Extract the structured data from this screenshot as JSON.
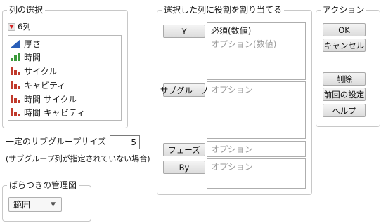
{
  "columns_panel": {
    "title": "列の選択",
    "count": "6列",
    "items": [
      {
        "label": "厚さ",
        "icon": "continuous-icon"
      },
      {
        "label": "時間",
        "icon": "ordinal-icon"
      },
      {
        "label": "サイクル",
        "icon": "nominal-icon"
      },
      {
        "label": "キャビティ",
        "icon": "nominal-icon"
      },
      {
        "label": "時間 サイクル",
        "icon": "nominal-icon"
      },
      {
        "label": "時間 キャビティ",
        "icon": "nominal-icon"
      }
    ]
  },
  "subgroup_size": {
    "label": "一定のサブグループサイズ",
    "value": "5",
    "note": "(サブグループ列が指定されていない場合)"
  },
  "chart_type": {
    "title": "ばらつきの管理図",
    "selected": "範囲"
  },
  "roles_panel": {
    "title": "選択した列に役割を割り当てる",
    "roles": [
      {
        "button": "Y",
        "lines": [
          {
            "text": "必須(数値)",
            "placeholder": false
          },
          {
            "text": "オプション(数値)",
            "placeholder": true
          }
        ]
      },
      {
        "button": "サブグループ",
        "lines": [
          {
            "text": "オプション",
            "placeholder": true
          }
        ]
      },
      {
        "button": "フェーズ",
        "lines": [
          {
            "text": "オプション",
            "placeholder": true
          }
        ]
      },
      {
        "button": "By",
        "lines": [
          {
            "text": "オプション",
            "placeholder": true
          }
        ]
      }
    ]
  },
  "actions_panel": {
    "title": "アクション",
    "ok": "OK",
    "cancel": "キャンセル",
    "remove": "削除",
    "recall": "前回の設定",
    "help": "ヘルプ"
  },
  "colors": {
    "continuous": "#2a5fb8",
    "ordinal": "#3b9a3b",
    "nominal": "#c0392b",
    "red_triangle": "#d32222"
  }
}
